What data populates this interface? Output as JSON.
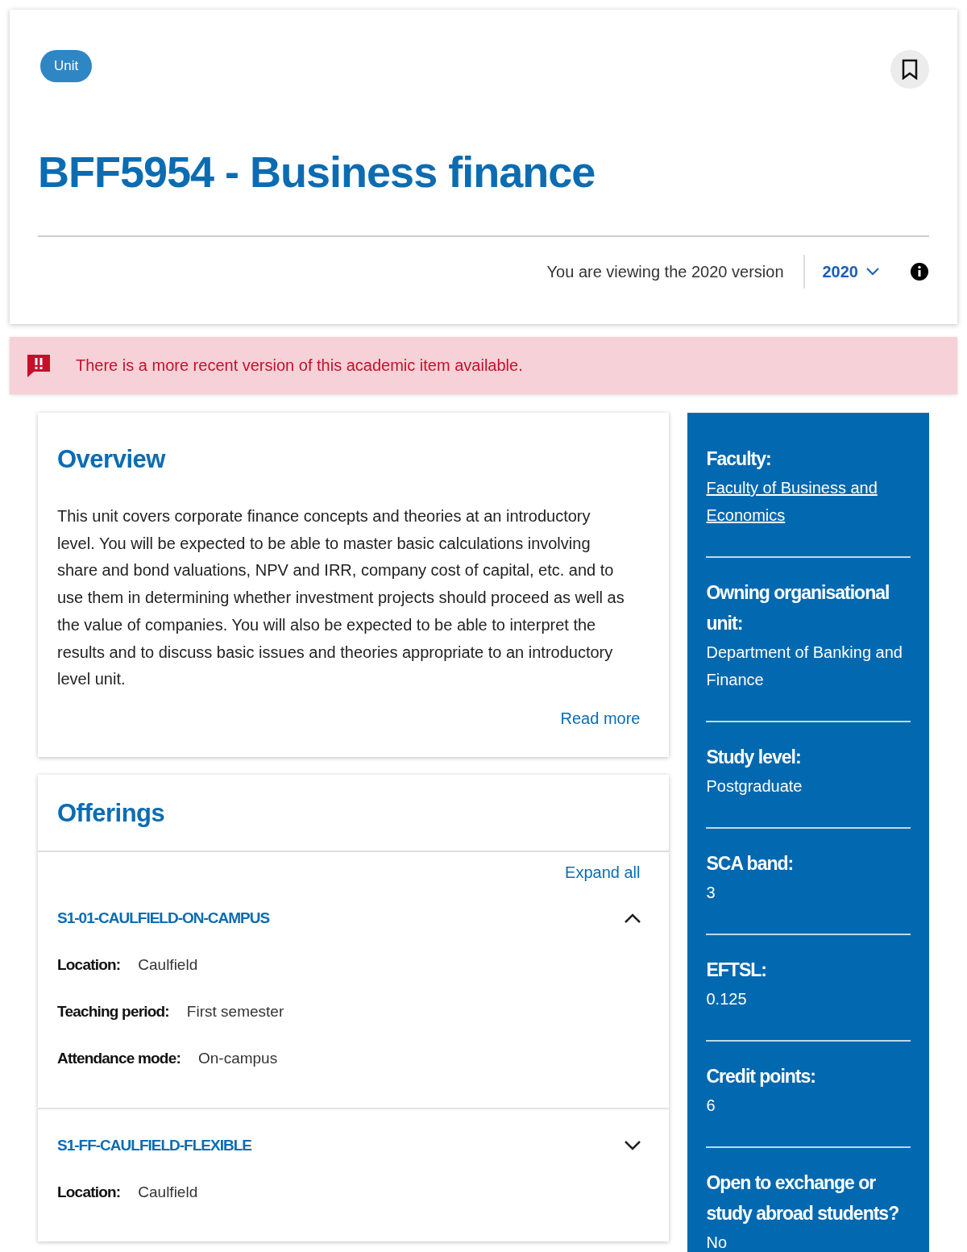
{
  "header": {
    "badge": "Unit",
    "title": "BFF5954 - Business finance",
    "version_text": "You are viewing the 2020 version",
    "version_select": "2020"
  },
  "alert": {
    "text": "There is a more recent version of this academic item available."
  },
  "overview": {
    "heading": "Overview",
    "body": "This unit covers corporate finance concepts and theories at an introductory level. You will be expected to be able to master basic calculations involving share and bond valuations, NPV and IRR, company cost of capital, etc. and to use them in determining whether investment projects should proceed as well as the value of companies. You will also be expected to be able to interpret the results and to discuss basic issues and theories appropriate to an introductory level unit.",
    "read_more": "Read more"
  },
  "offerings": {
    "heading": "Offerings",
    "expand_all": "Expand all",
    "items": [
      {
        "title": "S1-01-CAULFIELD-ON-CAMPUS",
        "expanded": true,
        "details": [
          {
            "label": "Location:",
            "value": "Caulfield"
          },
          {
            "label": "Teaching period:",
            "value": "First semester"
          },
          {
            "label": "Attendance mode:",
            "value": "On-campus"
          }
        ]
      },
      {
        "title": "S1-FF-CAULFIELD-FLEXIBLE",
        "expanded": false,
        "details": [
          {
            "label": "Location:",
            "value": "Caulfield"
          }
        ]
      }
    ]
  },
  "sidebar": {
    "items": [
      {
        "label": "Faculty:",
        "value": "Faculty of Business and Economics",
        "kind": "link"
      },
      {
        "label": "Owning organisational unit:",
        "value": "Department of Banking and Finance",
        "kind": "text"
      },
      {
        "label": "Study level:",
        "value": "Postgraduate",
        "kind": "text"
      },
      {
        "label": "SCA band:",
        "value": "3",
        "kind": "text"
      },
      {
        "label": "EFTSL:",
        "value": "0.125",
        "kind": "text"
      },
      {
        "label": "Credit points:",
        "value": "6",
        "kind": "text"
      },
      {
        "label": "Open to exchange or study abroad students?",
        "value": "No",
        "kind": "text"
      }
    ]
  }
}
